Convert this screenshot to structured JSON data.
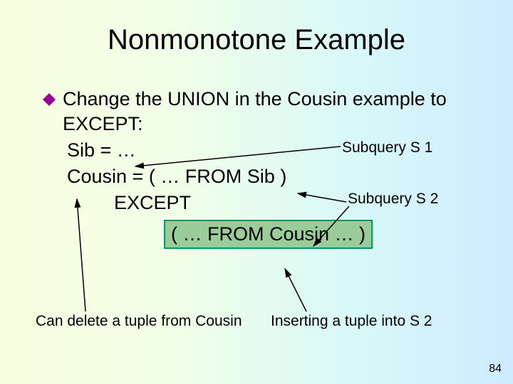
{
  "title": "Nonmotone Example",
  "bullet": {
    "text": "Change the UNION in the Cousin example to EXCEPT:"
  },
  "code": {
    "line1": "Sib = …",
    "line2": "Cousin = ( … FROM Sib )",
    "except": "EXCEPT",
    "boxed": "( … FROM Cousin … )"
  },
  "labels": {
    "s1": "Subquery S 1",
    "s2": "Subquery S 2"
  },
  "captions": {
    "left": "Can delete a tuple from Cousin",
    "right": "Inserting a tuple into S 2"
  },
  "page": "84",
  "title_actual": "Nonmonotone Example"
}
